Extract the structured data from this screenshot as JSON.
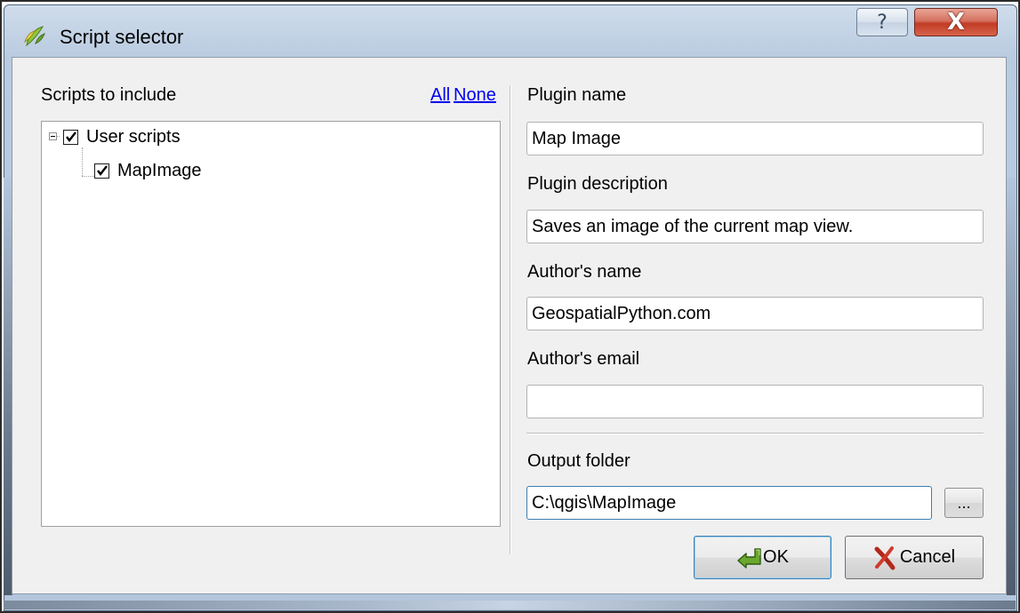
{
  "window": {
    "title": "Script selector",
    "help_label": "?",
    "close_label": "X"
  },
  "left_panel": {
    "header": "Scripts to include",
    "all_link": "All",
    "none_link": "None",
    "tree": [
      {
        "label": "User scripts",
        "checked": true,
        "expanded": true
      },
      {
        "label": "MapImage",
        "checked": true
      }
    ]
  },
  "form": {
    "plugin_name_label": "Plugin name",
    "plugin_name_value": "Map Image",
    "plugin_description_label": "Plugin description",
    "plugin_description_value": "Saves an image of the current map view.",
    "author_name_label": "Author's name",
    "author_name_value": "GeospatialPython.com",
    "author_email_label": "Author's email",
    "author_email_value": "",
    "output_folder_label": "Output folder",
    "output_folder_value": "C:\\qgis\\MapImage",
    "browse_label": "..."
  },
  "buttons": {
    "ok_label": "OK",
    "cancel_label": "Cancel"
  },
  "icons": {
    "app": "qgis-icon",
    "ok": "ok-arrow-icon",
    "cancel": "cancel-x-icon"
  }
}
